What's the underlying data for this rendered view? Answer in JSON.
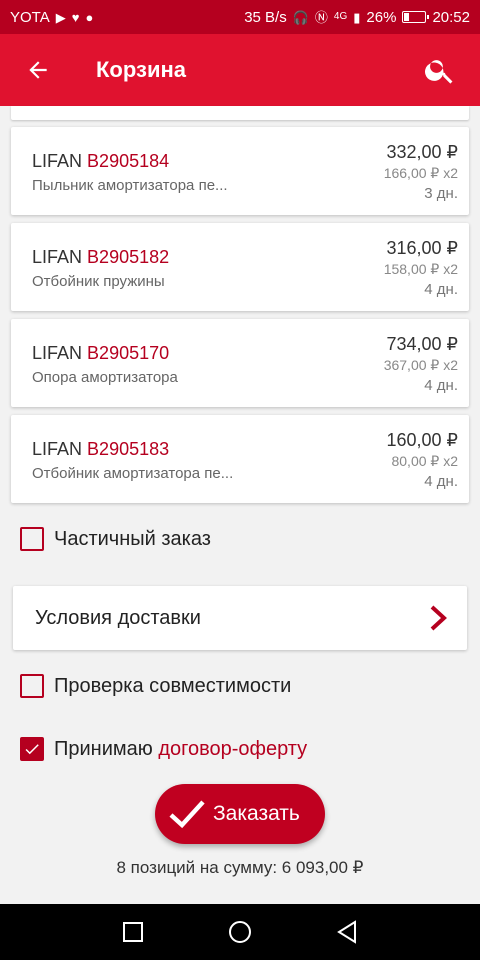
{
  "status_bar": {
    "carrier": "YOTA",
    "net_speed": "35 B/s",
    "network_type": "4G",
    "battery": "26%",
    "battery_level": 0.26,
    "time": "20:52"
  },
  "app_bar": {
    "title": "Корзина",
    "back_icon": "arrow-back-icon",
    "search_icon": "search-icon"
  },
  "items": [
    {
      "brand": "LIFAN",
      "code": "B2905184",
      "desc": "Пыльник амортизатора пе...",
      "price": "332,00 ₽",
      "unit": "166,00 ₽ x2",
      "days": "3 дн."
    },
    {
      "brand": "LIFAN",
      "code": "B2905182",
      "desc": "Отбойник пружины",
      "price": "316,00 ₽",
      "unit": "158,00 ₽ x2",
      "days": "4 дн."
    },
    {
      "brand": "LIFAN",
      "code": "B2905170",
      "desc": "Опора амортизатора",
      "price": "734,00 ₽",
      "unit": "367,00 ₽ x2",
      "days": "4 дн."
    },
    {
      "brand": "LIFAN",
      "code": "B2905183",
      "desc": "Отбойник амортизатора пе...",
      "price": "160,00 ₽",
      "unit": "80,00 ₽ x2",
      "days": "4 дн."
    }
  ],
  "options": {
    "partial_order": {
      "label": "Частичный заказ",
      "checked": false
    },
    "delivery": {
      "label": "Условия доставки"
    },
    "compatibility": {
      "label": "Проверка совместимости",
      "checked": false
    },
    "accept": {
      "prefix": "Принимаю ",
      "link": "договор-оферту",
      "checked": true
    }
  },
  "order_button": {
    "label": "Заказать"
  },
  "summary": "8 позиций на сумму: 6 093,00 ₽",
  "colors": {
    "status_bar": "#b5001f",
    "app_bar": "#e0122f",
    "accent": "#b5001f"
  }
}
